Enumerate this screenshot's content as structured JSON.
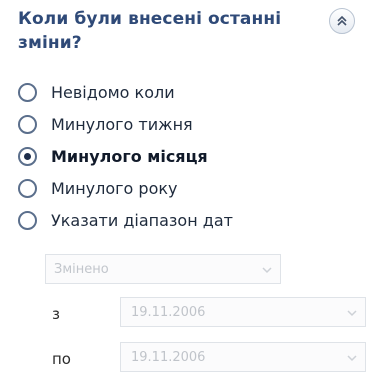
{
  "panel": {
    "title": "Коли були внесені останні зміни?",
    "collapse_icon": "double-chevron-up-icon"
  },
  "options": [
    {
      "label": "Невідомо коли",
      "selected": false
    },
    {
      "label": "Минулого тижня",
      "selected": false
    },
    {
      "label": "Минулого місяця",
      "selected": true
    },
    {
      "label": "Минулого року",
      "selected": false
    },
    {
      "label": "Указати діапазон дат",
      "selected": false
    }
  ],
  "range": {
    "type_value": "Змінено",
    "from_label": "з",
    "from_value": "19.11.2006",
    "to_label": "по",
    "to_value": "19.11.2006"
  },
  "colors": {
    "title": "#2f4a78",
    "disabled_text": "#c0c4ca"
  }
}
